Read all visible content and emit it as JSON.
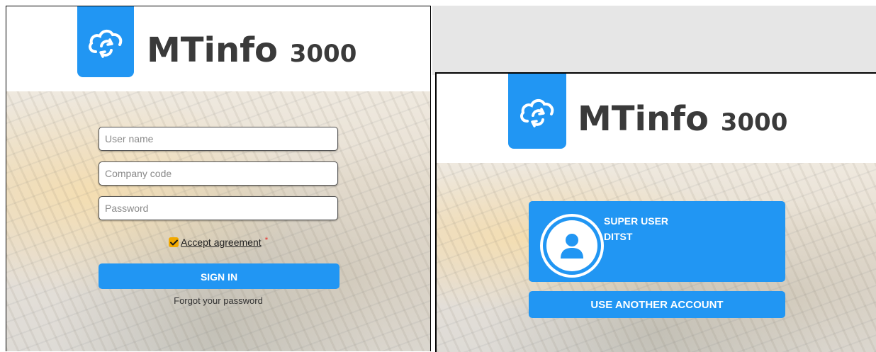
{
  "brand": {
    "name": "MTinfo",
    "version": "3000",
    "logo_icon": "cloud-sync-icon",
    "accent_color": "#2196f3"
  },
  "login_form": {
    "username_placeholder": "User name",
    "company_placeholder": "Company code",
    "password_placeholder": "Password",
    "agreement_label": "Accept agreement",
    "required_marker": "*",
    "agreement_checked": true,
    "sign_in_label": "SIGN IN",
    "forgot_label": "Forgot your password"
  },
  "account_picker": {
    "user_name": "SUPER USER",
    "company": "DITST",
    "avatar_icon": "user-avatar-icon",
    "another_account_label": "USE ANOTHER ACCOUNT"
  }
}
